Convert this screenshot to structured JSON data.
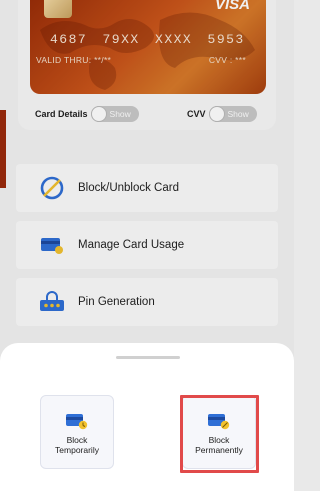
{
  "card": {
    "brand": "VISA",
    "number": "4687  79XX  XXXX  5953",
    "valid_thru": "VALID THRU: **/**",
    "cvv": "CVV : ***"
  },
  "toggles": {
    "card_details_label": "Card Details",
    "card_details_state": "Show",
    "cvv_label": "CVV",
    "cvv_state": "Show"
  },
  "menu": {
    "items": [
      {
        "label": "Block/Unblock Card",
        "icon": "block-card-icon"
      },
      {
        "label": "Manage Card Usage",
        "icon": "manage-card-icon"
      },
      {
        "label": "Pin Generation",
        "icon": "pin-generation-icon"
      }
    ]
  },
  "sheet": {
    "options": [
      {
        "label_line1": "Block",
        "label_line2": "Temporarily",
        "icon": "block-temporarily-icon"
      },
      {
        "label_line1": "Block",
        "label_line2": "Permanently",
        "icon": "block-permanently-icon"
      }
    ]
  },
  "colors": {
    "card_gradient_main": "#c9541a",
    "icon_blue": "#2f6fd6",
    "icon_yellow": "#f2c230",
    "highlight": "#e14a4a"
  }
}
